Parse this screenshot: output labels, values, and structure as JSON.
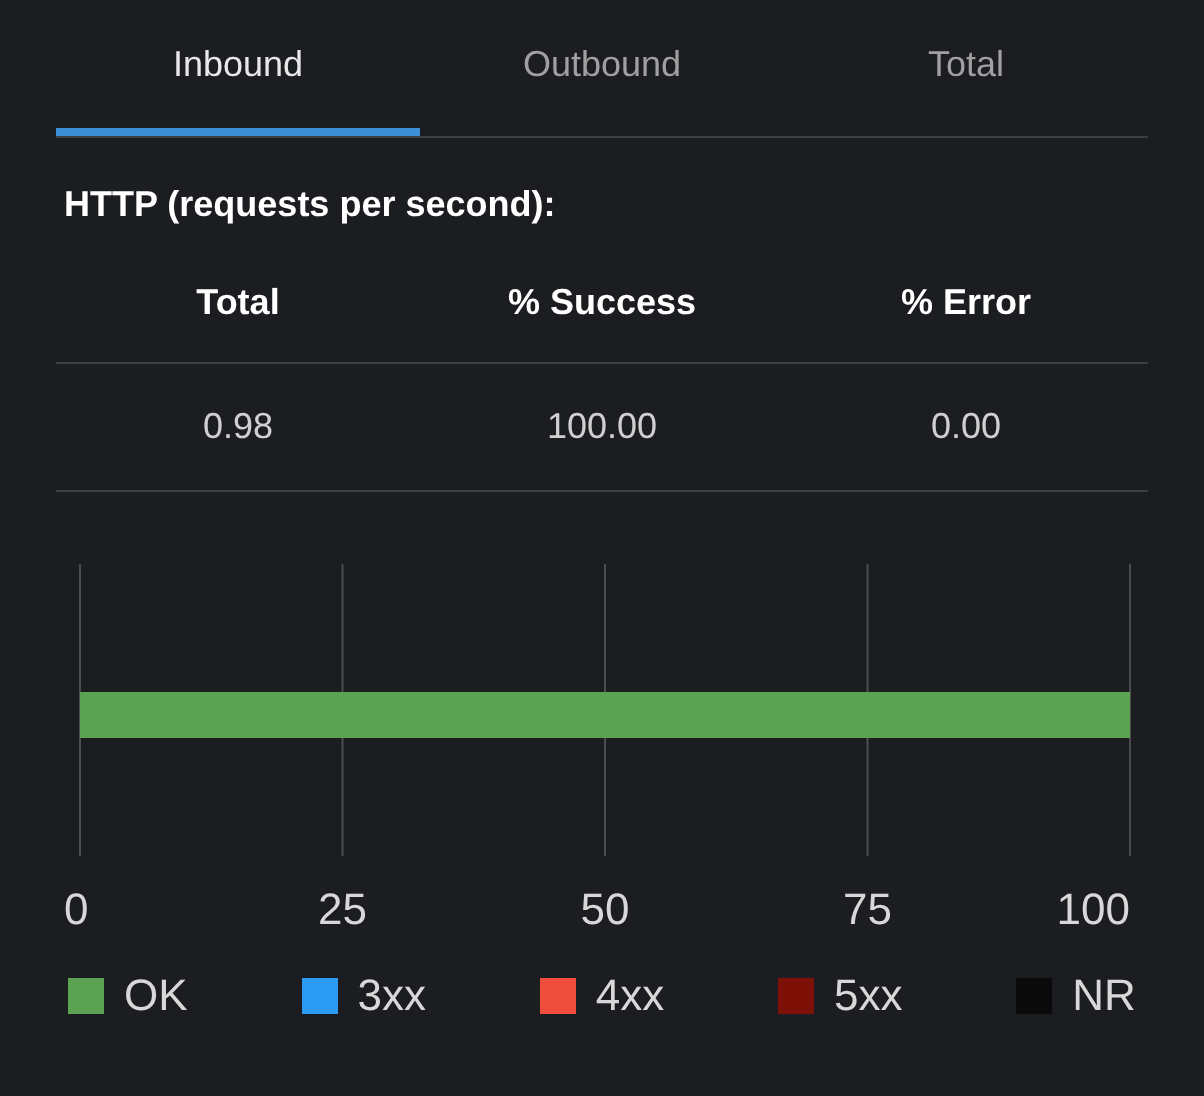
{
  "tabs": [
    {
      "label": "Inbound",
      "selected": true
    },
    {
      "label": "Outbound",
      "selected": false
    },
    {
      "label": "Total",
      "selected": false
    }
  ],
  "section_title": "HTTP (requests per second):",
  "table": {
    "columns": [
      "Total",
      "% Success",
      "% Error"
    ],
    "rows": [
      [
        "0.98",
        "100.00",
        "0.00"
      ]
    ]
  },
  "chart_data": {
    "type": "bar",
    "orientation": "horizontal",
    "stacked": true,
    "grid": true,
    "xlim": [
      0,
      100
    ],
    "xticks": [
      0,
      25,
      50,
      75,
      100
    ],
    "series": [
      {
        "name": "OK",
        "color": "#5ba352",
        "values": [
          100
        ]
      },
      {
        "name": "3xx",
        "color": "#2b9af3",
        "values": [
          0
        ]
      },
      {
        "name": "4xx",
        "color": "#ef4e3c",
        "values": [
          0
        ]
      },
      {
        "name": "5xx",
        "color": "#7d1007",
        "values": [
          0
        ]
      },
      {
        "name": "NR",
        "color": "#0a0a0a",
        "values": [
          0
        ]
      }
    ]
  }
}
